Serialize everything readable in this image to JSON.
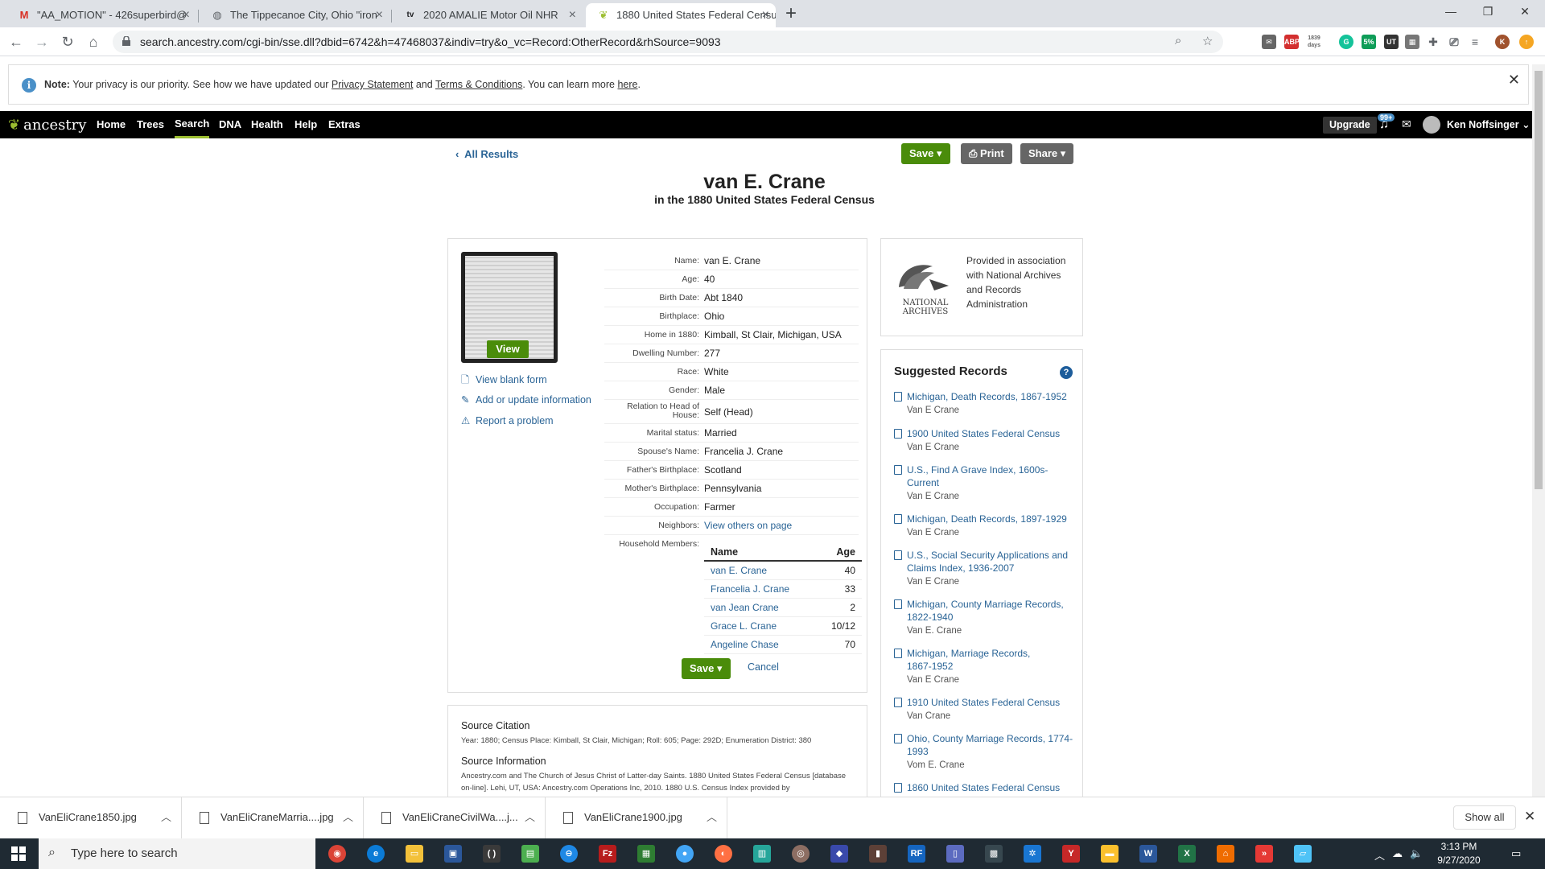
{
  "browser": {
    "tabs": [
      {
        "title": "\"AA_MOTION\" - 426superbird@",
        "icon": "gmail-icon"
      },
      {
        "title": "The Tippecanoe City, Ohio \"iron",
        "icon": "globe-icon"
      },
      {
        "title": "2020 AMALIE Motor Oil NHR",
        "icon": "tv-icon"
      },
      {
        "title": "1880 United States Federal Censu",
        "icon": "ancestry-leaf-icon"
      }
    ],
    "url": "search.ancestry.com/cgi-bin/sse.dll?dbid=6742&h=47468037&indiv=try&o_vc=Record:OtherRecord&rhSource=9093",
    "ext_badge_days": "1839",
    "ext_badge_pct": "5%"
  },
  "notice": {
    "label": "Note:",
    "text_before": "Your privacy is our priority. See how we have updated our",
    "privacy_link": "Privacy Statement",
    "and": "and",
    "terms_link": "Terms & Conditions",
    "text_after": ". You can learn more",
    "here_link": "here",
    "period": "."
  },
  "nav": {
    "logo": "ancestry",
    "items": [
      "Home",
      "Trees",
      "Search",
      "DNA",
      "Health",
      "Help",
      "Extras"
    ],
    "active": "Search",
    "upgrade": "Upgrade",
    "notif_badge": "99+",
    "user": "Ken Noffsinger"
  },
  "record": {
    "back_link": "All Results",
    "save": "Save",
    "print": "Print",
    "share": "Share",
    "title": "van E. Crane",
    "subtitle": "in the 1880 United States Federal Census",
    "view_button": "View",
    "side_links": [
      "View blank form",
      "Add or update information",
      "Report a problem"
    ],
    "facts": [
      {
        "label": "Name:",
        "value": "van E. Crane"
      },
      {
        "label": "Age:",
        "value": "40"
      },
      {
        "label": "Birth Date:",
        "value": "Abt 1840"
      },
      {
        "label": "Birthplace:",
        "value": "Ohio"
      },
      {
        "label": "Home in 1880:",
        "value": "Kimball, St Clair, Michigan, USA"
      },
      {
        "label": "Dwelling Number:",
        "value": "277"
      },
      {
        "label": "Race:",
        "value": "White"
      },
      {
        "label": "Gender:",
        "value": "Male"
      },
      {
        "label": "Relation to Head of House:",
        "value": "Self (Head)"
      },
      {
        "label": "Marital status:",
        "value": "Married"
      },
      {
        "label": "Spouse's Name:",
        "value": "Francelia J. Crane"
      },
      {
        "label": "Father's Birthplace:",
        "value": "Scotland"
      },
      {
        "label": "Mother's Birthplace:",
        "value": "Pennsylvania"
      },
      {
        "label": "Occupation:",
        "value": "Farmer"
      },
      {
        "label": "Neighbors:",
        "value": "View others on page"
      },
      {
        "label": "Household Members:",
        "value": ""
      }
    ],
    "household_headers": {
      "name": "Name",
      "age": "Age"
    },
    "household": [
      {
        "name": "van E. Crane",
        "age": "40"
      },
      {
        "name": "Francelia J. Crane",
        "age": "33"
      },
      {
        "name": "van Jean Crane",
        "age": "2"
      },
      {
        "name": "Grace L. Crane",
        "age": "10/12"
      },
      {
        "name": "Angeline Chase",
        "age": "70"
      }
    ],
    "card_save": "Save",
    "cancel": "Cancel"
  },
  "source": {
    "citation_title": "Source Citation",
    "citation_text": "Year: 1880; Census Place: Kimball, St Clair, Michigan; Roll: 605; Page: 292D; Enumeration District: 380",
    "info_title": "Source Information",
    "info_text": "Ancestry.com and The Church of Jesus Christ of Latter-day Saints. 1880 United States Federal Census [database on-line]. Lehi, UT, USA: Ancestry.com Operations Inc, 2010. 1880 U.S. Census Index provided by"
  },
  "nara": {
    "logo_line1": "NATIONAL",
    "logo_line2": "ARCHIVES",
    "text": "Provided in association with National Archives and Records Administration"
  },
  "suggested": {
    "title": "Suggested Records",
    "items": [
      {
        "title": "Michigan, Death Records, 1867-1952",
        "name": "Van E Crane"
      },
      {
        "title": "1900 United States Federal Census",
        "name": "Van E Crane"
      },
      {
        "title": "U.S., Find A Grave Index, 1600s-Current",
        "name": "Van E Crane"
      },
      {
        "title": "Michigan, Death Records, 1897-1929",
        "name": "Van E Crane"
      },
      {
        "title": "U.S., Social Security Applications and Claims Index, 1936-2007",
        "name": "Van E Crane"
      },
      {
        "title": "Michigan, County Marriage Records, 1822-1940",
        "name": "Van E. Crane"
      },
      {
        "title": "Michigan, Marriage Records, 1867-1952",
        "name": "Van E Crane"
      },
      {
        "title": "1910 United States Federal Census",
        "name": "Van Crane"
      },
      {
        "title": "Ohio, County Marriage Records, 1774-1993",
        "name": "Vom E. Crane"
      },
      {
        "title": "1860 United States Federal Census",
        "name": ""
      }
    ]
  },
  "downloads": {
    "files": [
      "VanEliCrane1850.jpg",
      "VanEliCraneMarria....jpg",
      "VanEliCraneCivilWa....j...",
      "VanEliCrane1900.jpg"
    ],
    "show_all": "Show all"
  },
  "taskbar": {
    "search_placeholder": "Type here to search",
    "time": "3:13 PM",
    "date": "9/27/2020"
  }
}
